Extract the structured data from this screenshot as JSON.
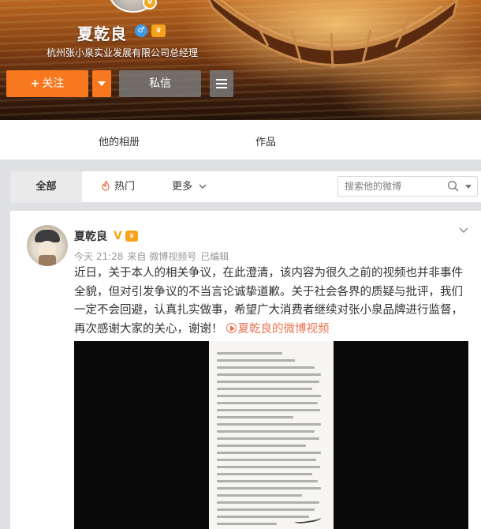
{
  "profile": {
    "name": "夏乾良",
    "description": "杭州张小泉实业发展有限公司总经理",
    "verified_icon": "v-verified-icon",
    "gender_icon": "male-icon",
    "member_icon": "member-crown-icon"
  },
  "actions": {
    "follow_label": "关注",
    "follow_plus": "+",
    "message_label": "私信"
  },
  "profile_tabs": [
    {
      "label": "他的相册"
    },
    {
      "label": "作品"
    }
  ],
  "feed_tabs": [
    {
      "label": "全部",
      "active": true
    },
    {
      "label": "热门",
      "icon": "fire-icon"
    },
    {
      "label": "更多",
      "icon": "chevron-down-icon"
    }
  ],
  "search": {
    "placeholder": "搜索他的微博"
  },
  "post": {
    "author": "夏乾良",
    "v_badge": "V",
    "time": "今天 21:28",
    "source": "来自 微博视频号",
    "edited": "已编辑",
    "text": "近日，关于本人的相关争议，在此澄清，该内容为很久之前的视频也并非事件全貌，但对引发争议的不当言论诚挚道歉。关于社会各界的质疑与批评，我们一定不会回避，认真扎实做事，希望广大消费者继续对张小泉品牌进行监督，再次感谢大家的关心，谢谢！",
    "link_text": "夏乾良的微博视频"
  },
  "colors": {
    "accent_orange": "#f7781f",
    "link_orange": "#eb7350",
    "verified_gold": "#f6a81a"
  }
}
